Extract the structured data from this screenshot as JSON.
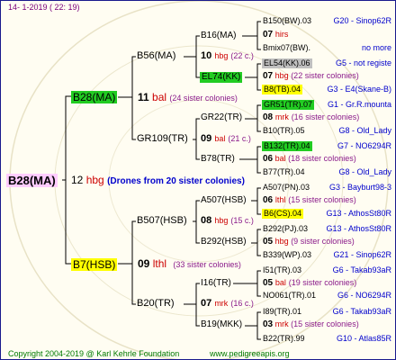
{
  "header": {
    "text": "14-  1-2019 ( 22: 19)"
  },
  "footer": {
    "copyright": "Copyright 2004-2019 @ Karl Kehrle Foundation",
    "url": "www.pedigreeapis.org"
  },
  "root": {
    "label": "B28(MA)",
    "number": "12",
    "mark": "hbg",
    "note": "(Drones from 20 sister colonies)"
  },
  "queen_b28": {
    "label": "B28(MA)",
    "number": "11",
    "mark": "bal",
    "note": "(24 sister colonies)"
  },
  "queen_b7": {
    "label": "B7(HSB)",
    "number": "09",
    "mark": "lthl",
    "note": "(33 sister colonies)"
  },
  "gen3": {
    "b56": {
      "label": "B56(MA)",
      "number": "10",
      "mark": "hbg",
      "note": "(22 c.)"
    },
    "gr109": {
      "label": "GR109(TR)",
      "number": "09",
      "mark": "bal",
      "note": "(21 c.)"
    },
    "b507": {
      "label": "B507(HSB)",
      "number": "08",
      "mark": "hbg",
      "note": "(15 c.)"
    },
    "b20": {
      "label": "B20(TR)",
      "number": "07",
      "mark": "mrk",
      "note": "(16 c.)"
    }
  },
  "gen4": {
    "b16": {
      "label": "B16(MA)",
      "number": "07",
      "mark": "hirs"
    },
    "el74": {
      "label": "EL74(KK)"
    },
    "gr22": {
      "label": "GR22(TR)",
      "number": "08",
      "mark": "mrk",
      "note": "(16 sister colonies)"
    },
    "b78": {
      "label": "B78(TR)"
    },
    "a507": {
      "label": "A507(HSB)",
      "number": "06",
      "mark": "lthl",
      "note": "(15 sister colonies)"
    },
    "b292": {
      "label": "B292(HSB)"
    },
    "i16": {
      "label": "I16(TR)",
      "number": "05",
      "mark": "bal",
      "note": "(19 sister colonies)"
    },
    "b19": {
      "label": "B19(MKK)"
    }
  },
  "gen5": {
    "b150": {
      "label": "B150(BW).03",
      "code": "G20 - Sinop62R"
    },
    "bmix07": {
      "label": "Bmix07(BW).",
      "code": "no more"
    },
    "el54": {
      "label": "EL54(KK).06",
      "code": "G5 - not registe"
    },
    "el54_child": {
      "number": "07",
      "mark": "hbg",
      "note": "(22 sister colonies)"
    },
    "b8": {
      "label": "B8(TB).04",
      "code": "G3 - E4(Skane-B)"
    },
    "gr51": {
      "label": "GR51(TR).07",
      "code": "G1 - Gr.R.mounta"
    },
    "b10": {
      "label": "B10(TR).05",
      "code": "G8 - Old_Lady"
    },
    "b132": {
      "label": "B132(TR).04",
      "code": "G7 - NO6294R"
    },
    "b132_child": {
      "number": "06",
      "mark": "bal",
      "note": "(18 sister colonies)"
    },
    "b77": {
      "label": "B77(TR).04",
      "code": "G8 - Old_Lady"
    },
    "a507pn": {
      "label": "A507(PN).03",
      "code": "G3 - Bayburt98-3"
    },
    "b6": {
      "label": "B6(CS).04",
      "code": "G13 - AthosSt80R"
    },
    "b292pj": {
      "label": "B292(PJ).03",
      "code": "G13 - AthosSt80R"
    },
    "b292_child": {
      "number": "05",
      "mark": "hbg",
      "note": "(9 sister colonies)"
    },
    "b339": {
      "label": "B339(WP).03",
      "code": "G21 - Sinop62R"
    },
    "i51": {
      "label": "I51(TR).03",
      "code": "G6 - Takab93aR"
    },
    "no061": {
      "label": "NO061(TR).01",
      "code": "G6 - NO6294R"
    },
    "i89": {
      "label": "I89(TR).01",
      "code": "G6 - Takab93aR"
    },
    "i89_child": {
      "number": "03",
      "mark": "mrk",
      "note": "(15 sister colonies)"
    },
    "b22": {
      "label": "B22(TR).99",
      "code": "G10 - Atlas85R"
    }
  },
  "colors": {
    "border": "#1a1a8c",
    "green": "#22cc22",
    "yellow": "#ffff00",
    "pink": "#ffccff",
    "gray": "#c0c0c0",
    "line": "#000000"
  }
}
